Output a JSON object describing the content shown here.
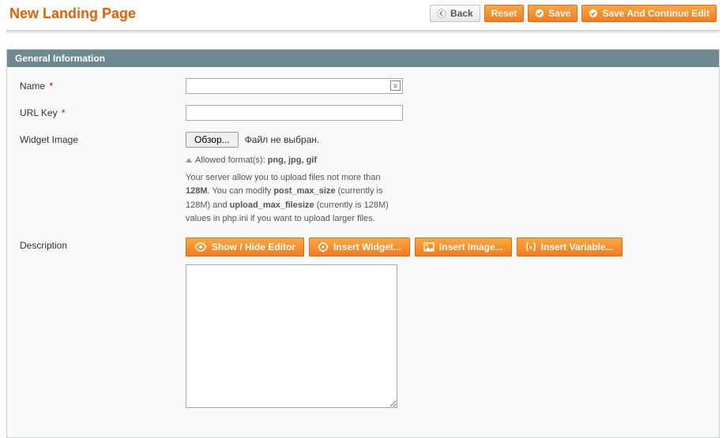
{
  "header": {
    "title": "New Landing Page",
    "buttons": {
      "back": "Back",
      "reset": "Reset",
      "save": "Save",
      "save_continue": "Save And Continue Edit"
    }
  },
  "panel": {
    "title": "General Information"
  },
  "fields": {
    "name": {
      "label": "Name",
      "value": ""
    },
    "url_key": {
      "label": "URL Key",
      "value": ""
    },
    "widget_image": {
      "label": "Widget Image",
      "browse_btn": "Обзор...",
      "no_file": "Файл не выбран.",
      "hint_prefix": "Allowed format(s): ",
      "hint_formats": "png, jpg, gif",
      "hint_l1a": "Your server allow you to upload files not more than ",
      "hint_l1b": "128M",
      "hint_l1c": ". You can modify ",
      "hint_l1d": "post_max_size",
      "hint_l1e": " (currently is 128M) and ",
      "hint_l1f": "upload_max_filesize",
      "hint_l1g": " (currently is 128M) values in php.ini if you want to upload larger files."
    },
    "description": {
      "label": "Description",
      "value": "",
      "buttons": {
        "toggle": "Show / Hide Editor",
        "widget": "Insert Widget...",
        "image": "Insert Image...",
        "variable": "Insert Variable..."
      }
    }
  }
}
